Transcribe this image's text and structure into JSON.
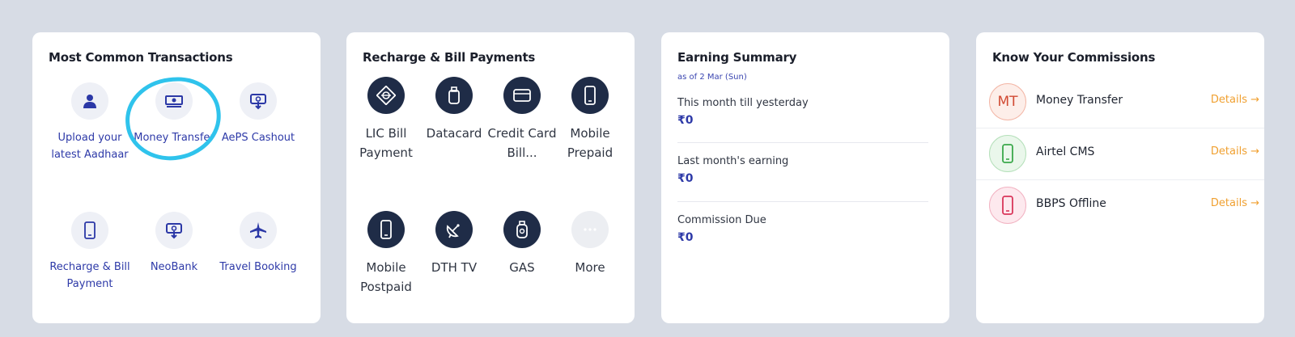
{
  "common": {
    "title": "Most Common Transactions",
    "items": [
      {
        "label": "Upload your latest Aadhaar",
        "icon": "user-icon"
      },
      {
        "label": "Money Transfer",
        "icon": "banknote-icon"
      },
      {
        "label": "AePS Cashout",
        "icon": "cash-withdraw-icon"
      },
      {
        "label": "Recharge & Bill Payment",
        "icon": "mobile-icon"
      },
      {
        "label": "NeoBank",
        "icon": "cash-withdraw-icon"
      },
      {
        "label": "Travel Booking",
        "icon": "airplane-icon"
      }
    ]
  },
  "recharge": {
    "title": "Recharge & Bill Payments",
    "items": [
      {
        "label": "LIC Bill Payment",
        "icon": "lic-icon"
      },
      {
        "label": "Datacard",
        "icon": "datacard-icon"
      },
      {
        "label": "Credit Card Bill...",
        "icon": "credit-card-icon"
      },
      {
        "label": "Mobile Prepaid",
        "icon": "mobile-icon"
      },
      {
        "label": "Mobile Postpaid",
        "icon": "mobile-icon"
      },
      {
        "label": "DTH TV",
        "icon": "satellite-dish-icon"
      },
      {
        "label": "GAS",
        "icon": "gas-cylinder-icon"
      },
      {
        "label": "More",
        "icon": "more-dots-icon"
      }
    ]
  },
  "earning": {
    "title": "Earning Summary",
    "as_of": "as of 2 Mar (Sun)",
    "rows": [
      {
        "label": "This month till yesterday",
        "value": "₹0"
      },
      {
        "label": "Last month's earning",
        "value": "₹0"
      },
      {
        "label": "Commission Due",
        "value": "₹0"
      }
    ]
  },
  "commissions": {
    "title": "Know Your Commissions",
    "details_label": "Details →",
    "items": [
      {
        "name": "Money Transfer",
        "avatar_text": "MT",
        "color": "#e8563f",
        "bg": "#fdeee9"
      },
      {
        "name": "Airtel CMS",
        "avatar_text": "",
        "color": "#3aa84a",
        "bg": "#eaf7eb"
      },
      {
        "name": "BBPS Offline",
        "avatar_text": "",
        "color": "#d9365a",
        "bg": "#fde9ee"
      }
    ]
  },
  "colors": {
    "accent": "#2e3aa8",
    "highlight": "#2fc3ec",
    "details": "#f0a030"
  }
}
